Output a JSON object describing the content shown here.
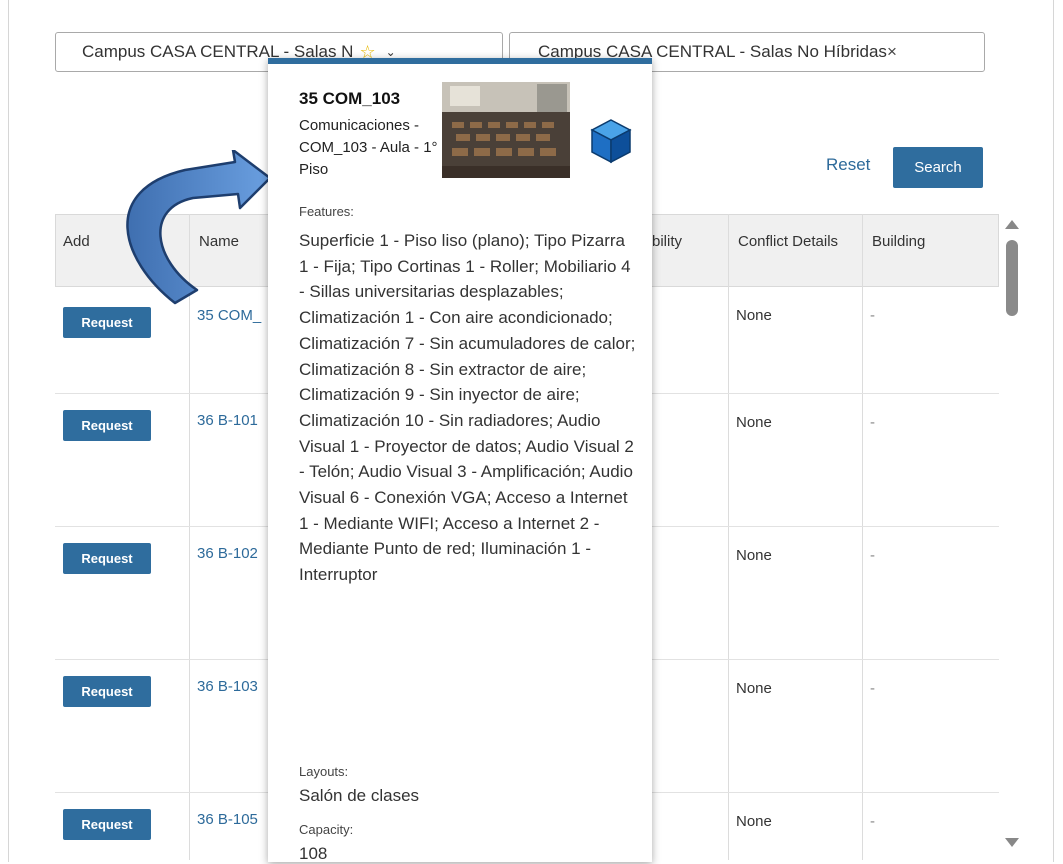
{
  "filters": {
    "filter1": {
      "text": "Campus CASA CENTRAL - Salas N",
      "star": "☆",
      "chevron": "⌄"
    },
    "filter2": {
      "text": "Campus CASA CENTRAL - Salas No Híbridas",
      "remove": "×"
    }
  },
  "actions": {
    "reset": "Reset",
    "search": "Search"
  },
  "table": {
    "headers": {
      "add": "Add",
      "name": "Name",
      "availability": "bility",
      "conflict": "Conflict Details",
      "building": "Building"
    },
    "rows": [
      {
        "action": "Request",
        "name": "35 COM_",
        "conflict": "None",
        "building": "-"
      },
      {
        "action": "Request",
        "name": "36 B-101",
        "conflict": "None",
        "building": "-"
      },
      {
        "action": "Request",
        "name": "36 B-102",
        "conflict": "None",
        "building": "-"
      },
      {
        "action": "Request",
        "name": "36 B-103",
        "conflict": "None",
        "building": "-"
      },
      {
        "action": "Request",
        "name": "36 B-105",
        "conflict": "None",
        "building": "-"
      }
    ]
  },
  "popup": {
    "title": "35 COM_103",
    "subtitle": "Comunicaciones - COM_103 - Aula - 1° Piso",
    "features_label": "Features:",
    "features": "Superficie 1 - Piso liso (plano); Tipo Pizarra 1 - Fija; Tipo Cortinas 1 - Roller; Mobiliario 4 - Sillas universitarias desplazables; Climatización 1 - Con aire acondicionado; Climatización 7 - Sin acumuladores de calor; Climatización 8 - Sin extractor de aire; Climatización 9 - Sin inyector de aire; Climatización 10 - Sin radiadores; Audio Visual 1 - Proyector de datos; Audio Visual 2 - Telón; Audio Visual 3 - Amplificación; Audio Visual 6 - Conexión VGA; Acceso a Internet 1 - Mediante WIFI; Acceso a Internet 2 - Mediante Punto de red; Iluminación 1 - Interruptor",
    "layouts_label": "Layouts:",
    "layouts": "Salón de clases",
    "capacity_label": "Capacity:",
    "capacity": "108"
  },
  "colors": {
    "accent": "#2f6d9e",
    "link": "#2d6a9a",
    "header_bg": "#f0f0f0"
  },
  "icons": {
    "cube": "3d-cube-icon",
    "arrow": "curved-arrow-icon"
  }
}
